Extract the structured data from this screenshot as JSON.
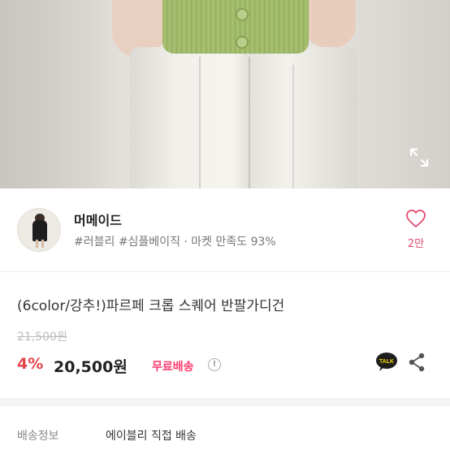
{
  "photo": {
    "expand_icon": "expand-icon"
  },
  "seller": {
    "name": "머메이드",
    "tags": "#러블리 #심플베이직 · 마켓 만족도 93%",
    "likes": "2만",
    "like_icon": "heart-outline-icon",
    "accent_color": "#e24a6b"
  },
  "product": {
    "title": "(6color/강추!)파르페 크롭 스퀘어 반팔가디건",
    "original_price": "21,500원",
    "discount": "4%",
    "price": "20,500원",
    "free_shipping": "무료배송",
    "info_mark": "!",
    "talk_icon": "kakaotalk-icon",
    "talk_label": "TALK",
    "share_icon": "share-icon",
    "discount_color": "#e2464d",
    "free_shipping_color": "#ff3a6e"
  },
  "shipping": {
    "label": "배송정보",
    "value": "에이블리 직접 배송"
  }
}
